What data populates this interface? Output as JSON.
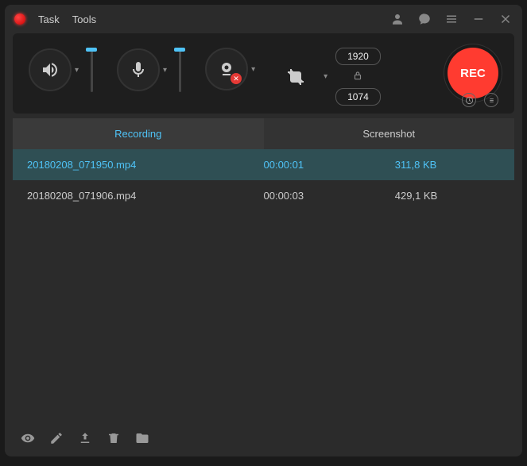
{
  "titlebar": {
    "menu": {
      "task": "Task",
      "tools": "Tools"
    }
  },
  "dimensions": {
    "width": "1920",
    "height": "1074"
  },
  "rec_label": "REC",
  "tabs": {
    "recording": "Recording",
    "screenshot": "Screenshot"
  },
  "recordings": [
    {
      "name": "20180208_071950.mp4",
      "duration": "00:00:01",
      "size": "311,8 KB",
      "selected": true
    },
    {
      "name": "20180208_071906.mp4",
      "duration": "00:00:03",
      "size": "429,1 KB",
      "selected": false
    }
  ]
}
